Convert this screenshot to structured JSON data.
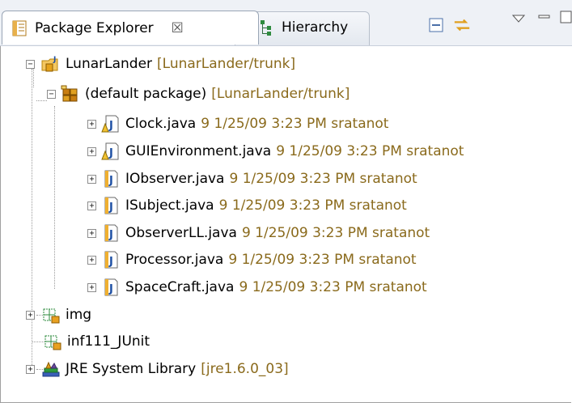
{
  "tabs": {
    "active": {
      "label": "Package Explorer",
      "close": "☒"
    },
    "inactive": {
      "label": "Hierarchy"
    }
  },
  "toolbar": {
    "collapse_icon": "collapse-all-icon",
    "link_icon": "link-with-editor-icon",
    "menu_icon": "view-menu-icon",
    "minimize_icon": "minimize-icon"
  },
  "tree": {
    "project": {
      "name": "LunarLander",
      "deco": "[LunarLander/trunk]"
    },
    "package": {
      "name": "(default package)",
      "deco": "[LunarLander/trunk]"
    },
    "files": [
      {
        "name": "Clock.java",
        "deco": "9  1/25/09 3:23 PM  sratanot",
        "warning": true
      },
      {
        "name": "GUIEnvironment.java",
        "deco": "9  1/25/09 3:23 PM  sratanot",
        "warning": true
      },
      {
        "name": "IObserver.java",
        "deco": "9  1/25/09 3:23 PM  sratanot",
        "warning": false
      },
      {
        "name": "ISubject.java",
        "deco": "9  1/25/09 3:23 PM  sratanot",
        "warning": false
      },
      {
        "name": "ObserverLL.java",
        "deco": "9  1/25/09 3:23 PM  sratanot",
        "warning": false
      },
      {
        "name": "Processor.java",
        "deco": "9  1/25/09 3:23 PM  sratanot",
        "warning": false
      },
      {
        "name": "SpaceCraft.java",
        "deco": "9  1/25/09 3:23 PM  sratanot",
        "warning": false
      }
    ],
    "folders": [
      {
        "name": "img"
      },
      {
        "name": "inf111_JUnit"
      }
    ],
    "library": {
      "name": "JRE System Library",
      "deco": "[jre1.6.0_03]"
    }
  },
  "colors": {
    "decoration": "#8a6a1c",
    "tab_bg": "#eef1f6"
  }
}
